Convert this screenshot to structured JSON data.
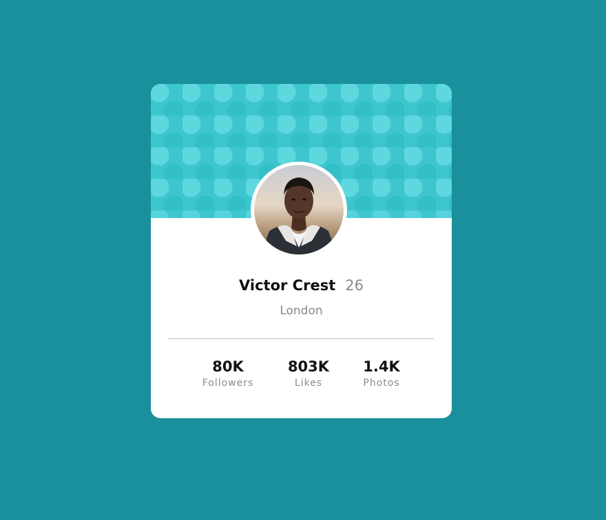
{
  "profile": {
    "name": "Victor Crest",
    "age": "26",
    "city": "London"
  },
  "stats": [
    {
      "value": "80K",
      "label": "Followers"
    },
    {
      "value": "803K",
      "label": "Likes"
    },
    {
      "value": "1.4K",
      "label": "Photos"
    }
  ],
  "colors": {
    "page_background": "#19909b",
    "banner": "#3ec6cf",
    "card": "#ffffff",
    "primary_text": "#111111",
    "secondary_text": "#8a8a8a"
  }
}
